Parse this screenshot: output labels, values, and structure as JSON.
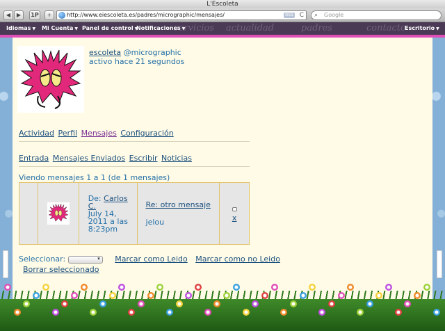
{
  "window": {
    "title": "L'Escoleta"
  },
  "toolbar": {
    "back": "◀",
    "forward": "▶",
    "onepass": "1P",
    "add": "+",
    "url": "http://www.eiescoleta.es/padres/micrographic/mensajes/",
    "rss": "RSS",
    "reload": "C",
    "search_placeholder": "Google"
  },
  "navbar": {
    "items": [
      {
        "label": "Idiomas"
      },
      {
        "label": "Mi Cuenta"
      },
      {
        "label": "Panel de control"
      },
      {
        "label": "Notificaciones"
      }
    ],
    "right_item": "Escritorio",
    "watermarks": [
      "servicios",
      "actualidad",
      "padres",
      "contacto"
    ]
  },
  "profile": {
    "name": "escoleta",
    "handle": "@micrographic",
    "activity": "activo hace 21 segundos"
  },
  "tabs": [
    {
      "label": "Actividad"
    },
    {
      "label": "Perfil"
    },
    {
      "label": "Mensajes",
      "active": true
    },
    {
      "label": "Configuración"
    }
  ],
  "subtabs": [
    {
      "label": "Entrada"
    },
    {
      "label": "Mensajes Enviados"
    },
    {
      "label": "Escribir"
    },
    {
      "label": "Noticias"
    }
  ],
  "messages": {
    "viewing": "Viendo mensajes 1 a 1 (de 1 mensajes)",
    "rows": [
      {
        "from_label": "De:",
        "sender": "Carlos C.",
        "date": "July 14, 2011 a las 8:23pm",
        "subject": "Re: otro mensaje",
        "body": "jelou",
        "delete": "x"
      }
    ]
  },
  "actions": {
    "select_label": "Seleccionar:",
    "mark_read": "Marcar como Leido",
    "mark_unread": "Marcar como no Leido",
    "delete_selected": "Borrar seleccionado"
  },
  "colors": {
    "nav_bg": "#4a3a55",
    "accent_pink": "#e04fb7",
    "panel_bg": "#fffbe6",
    "link": "#2470a8",
    "table_border": "#e2c26b"
  }
}
